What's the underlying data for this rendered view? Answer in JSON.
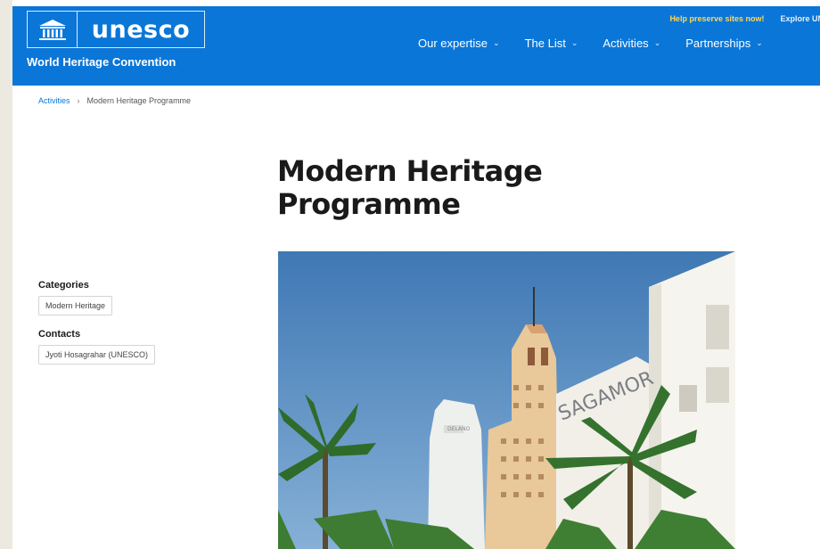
{
  "header": {
    "logo_text": "unesco",
    "subtitle": "World Heritage Convention",
    "top_links": [
      "Help preserve sites now!",
      "Explore UNE"
    ],
    "nav": [
      {
        "label": "Our expertise"
      },
      {
        "label": "The List"
      },
      {
        "label": "Activities"
      },
      {
        "label": "Partnerships"
      }
    ]
  },
  "breadcrumb": {
    "parent": "Activities",
    "current": "Modern Heritage Programme"
  },
  "page": {
    "title": "Modern Heritage Programme"
  },
  "sidebar": {
    "categories_heading": "Categories",
    "category_tag": "Modern Heritage",
    "contacts_heading": "Contacts",
    "contact_tag": "Jyoti Hosagrahar (UNESCO)"
  },
  "hero": {
    "sign_text": "SAGAMOR",
    "small_sign": "DELANO"
  },
  "colors": {
    "brand_blue": "#0a76d8",
    "top_link_yellow": "#ffd75a",
    "sky": "#5f92c6"
  },
  "icons": {
    "logo_emblem": "temple-icon",
    "nav_chevron": "chevron-down-icon",
    "breadcrumb_separator": "chevron-right-icon"
  }
}
